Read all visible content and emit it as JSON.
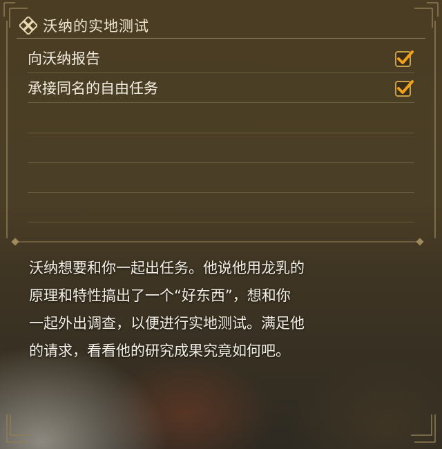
{
  "quest": {
    "title": "沃纳的实地测试",
    "objectives": [
      {
        "label": "向沃纳报告",
        "completed": true
      },
      {
        "label": "承接同名的自由任务",
        "completed": true
      }
    ],
    "description_lines": [
      "沃纳想要和你一起出任务。他说他用龙乳的",
      "原理和特性搞出了一个“好东西”，想和你",
      "一起外出调查，以便进行实地测试。满足他",
      "的请求，看看他的研究成果究竟如何吧。"
    ]
  },
  "colors": {
    "text": "#f1ecdf",
    "check_accent": "#f0a11c",
    "frame_gold": "#9c8a5e"
  },
  "icons": {
    "title_icon": "quest-emblem-icon",
    "objective_status": "checkbox-checked-icon"
  }
}
